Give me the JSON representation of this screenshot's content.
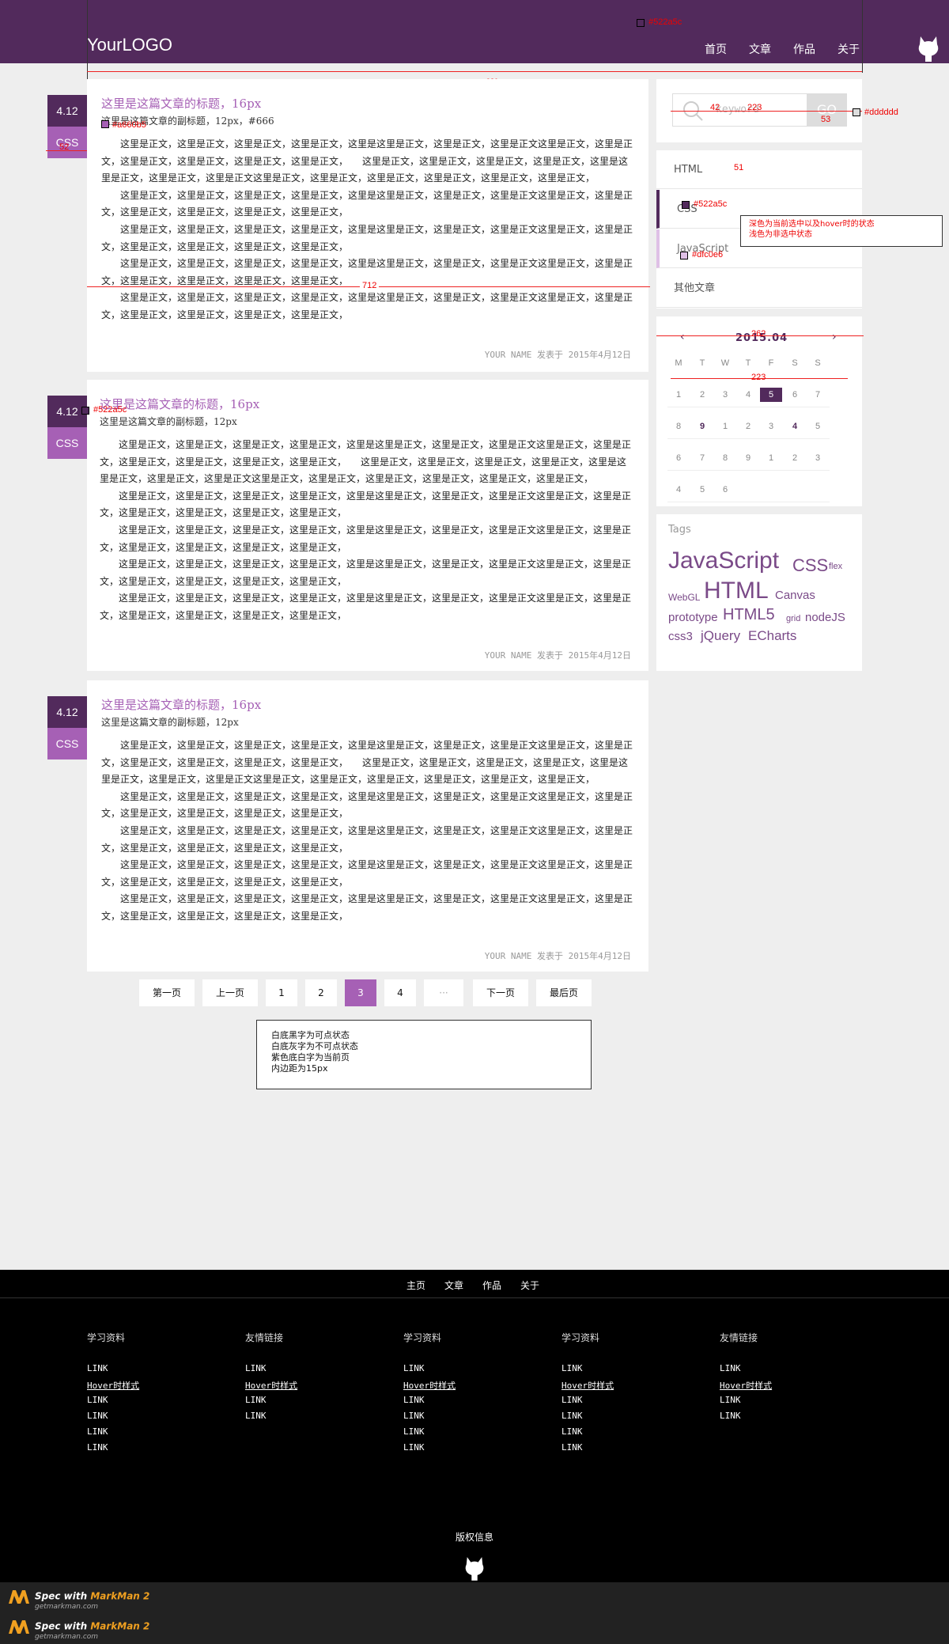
{
  "header": {
    "logo": "YourLOGO",
    "nav": [
      "首页",
      "文章",
      "作品",
      "关于"
    ]
  },
  "posts": [
    {
      "date": "4.12",
      "category": "CSS",
      "title": "这里是这篇文章的标题，16px",
      "subtitle": "这里是这篇文章的副标题，12px，#666",
      "meta": "YOUR NAME 发表于 2015年4月12日"
    },
    {
      "date": "4.12",
      "category": "CSS",
      "title": "这里是这篇文章的标题，16px",
      "subtitle": "这里是这篇文章的副标题，12px",
      "meta": "YOUR NAME 发表于 2015年4月12日"
    },
    {
      "date": "4.12",
      "category": "CSS",
      "title": "这里是这篇文章的标题，16px",
      "subtitle": "这里是这篇文章的副标题，12px",
      "meta": "YOUR NAME 发表于 2015年4月12日"
    }
  ],
  "post_body": [
    "这里是正文，这里是正文，这里是正文，这里是正文，这里是这里是正文，这里是正文，这里是正文这里是正文，这里是正文，这里是正文，这里是正文，这里是正文，这里是正文，　　这里是正文，这里是正文，这里是正文，这里是正文，这里是这里是正文，这里是正文，这里是正文这里是正文，这里是正文，这里是正文，这里是正文，这里是正文，这里是正文，",
    "这里是正文，这里是正文，这里是正文，这里是正文，这里是这里是正文，这里是正文，这里是正文这里是正文，这里是正文，这里是正文，这里是正文，这里是正文，这里是正文，",
    "这里是正文，这里是正文，这里是正文，这里是正文，这里是这里是正文，这里是正文，这里是正文这里是正文，这里是正文，这里是正文，这里是正文，这里是正文，这里是正文，",
    "这里是正文，这里是正文，这里是正文，这里是正文，这里是这里是正文，这里是正文，这里是正文这里是正文，这里是正文，这里是正文，这里是正文，这里是正文，这里是正文，",
    "这里是正文，这里是正文，这里是正文，这里是正文，这里是这里是正文，这里是正文，这里是正文这里是正文，这里是正文，这里是正文，这里是正文，这里是正文，这里是正文，"
  ],
  "search": {
    "placeholder": "keyword",
    "button": "GO"
  },
  "categories": [
    {
      "label": "HTML",
      "state": "normal"
    },
    {
      "label": "CSS",
      "state": "active"
    },
    {
      "label": "JavaScript",
      "state": "light"
    },
    {
      "label": "其他文章",
      "state": "normal"
    }
  ],
  "calendar": {
    "month": "2015.04",
    "prev": "‹",
    "next": "›",
    "weekdays": [
      "M",
      "T",
      "W",
      "T",
      "F",
      "S",
      "S"
    ],
    "rows": [
      [
        "1",
        "2",
        "3",
        "4",
        "5",
        "6",
        "7"
      ],
      [
        "8",
        "9",
        "1",
        "2",
        "3",
        "4",
        "5"
      ],
      [
        "6",
        "7",
        "8",
        "9",
        "1",
        "2",
        "3"
      ],
      [
        "4",
        "5",
        "6",
        "",
        "",
        "",
        ""
      ]
    ],
    "selected": "5",
    "bold": [
      "9",
      "4"
    ]
  },
  "tags": {
    "title": "Tags",
    "items": [
      "JavaScript",
      "CSS",
      "flex",
      "WebGL",
      "HTML",
      "Canvas",
      "prototype",
      "HTML5",
      "grid",
      "nodeJS",
      "css3",
      "jQuery",
      "ECharts"
    ]
  },
  "pagination": {
    "items": [
      "第一页",
      "上一页",
      "1",
      "2",
      "3",
      "4",
      "···",
      "下一页",
      "最后页"
    ],
    "current": "3",
    "note": [
      "白底黑字为可点状态",
      "白底灰字为不可点状态",
      "紫色底白字为当前页",
      "内边距为15px"
    ]
  },
  "footer": {
    "nav": [
      "主页",
      "文章",
      "作品",
      "关于"
    ],
    "columns": [
      {
        "title": "学习资料",
        "links": [
          "LINK",
          "Hover时样式",
          "LINK",
          "LINK",
          "LINK",
          "LINK"
        ]
      },
      {
        "title": "友情链接",
        "links": [
          "LINK",
          "Hover时样式",
          "LINK",
          "LINK"
        ]
      },
      {
        "title": "学习资料",
        "links": [
          "LINK",
          "Hover时样式",
          "LINK",
          "LINK",
          "LINK",
          "LINK"
        ]
      },
      {
        "title": "学习资料",
        "links": [
          "LINK",
          "Hover时样式",
          "LINK",
          "LINK",
          "LINK",
          "LINK"
        ]
      },
      {
        "title": "友情链接",
        "links": [
          "LINK",
          "Hover时样式",
          "LINK",
          "LINK"
        ]
      }
    ],
    "copyright": "版权信息"
  },
  "annotations": {
    "purple_hex": "#522a5c",
    "title_hex": "#a660b5",
    "light_hex": "#dfc0e6",
    "gray_hex": "#dddddd",
    "w980": "980px",
    "w712": "712",
    "w262": "262",
    "w223": "223",
    "h42": "42",
    "w223s": "223",
    "w53": "53",
    "h51": "51",
    "w52": "52",
    "state_note": [
      "深色为当前选中以及hover时的状态",
      "浅色为非选中状态"
    ]
  },
  "markman": {
    "line1": "Spec with",
    "brand": "MarkMan 2",
    "site": "getmarkman.com"
  },
  "colors": {
    "purple": "#522a5c",
    "accent": "#a660b5",
    "light": "#dfc0e6",
    "gray": "#dddddd"
  }
}
